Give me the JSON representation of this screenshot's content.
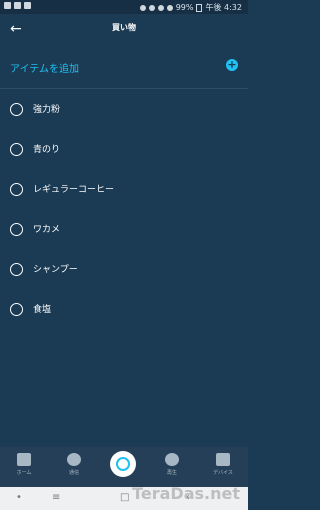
{
  "status_bar": {
    "battery": "99%",
    "time": "午後 4:32"
  },
  "header": {
    "title": "買い物",
    "back_icon": "arrow-left-icon"
  },
  "add_item": {
    "label": "アイテムを追加",
    "icon": "plus-circle-icon"
  },
  "items": [
    {
      "label": "強力粉",
      "checked": false
    },
    {
      "label": "青のり",
      "checked": false
    },
    {
      "label": "レギュラーコーヒー",
      "checked": false
    },
    {
      "label": "ワカメ",
      "checked": false
    },
    {
      "label": "シャンプー",
      "checked": false
    },
    {
      "label": "食塩",
      "checked": false
    }
  ],
  "bottom_nav": [
    {
      "label": "ホーム",
      "icon": "home-icon"
    },
    {
      "label": "通信",
      "icon": "chat-icon"
    },
    {
      "label": "",
      "icon": "alexa-icon"
    },
    {
      "label": "再生",
      "icon": "play-icon"
    },
    {
      "label": "デバイス",
      "icon": "devices-icon"
    }
  ],
  "watermark": "TeraDas.net",
  "colors": {
    "background": "#1b3a53",
    "accent": "#1fc0f2"
  }
}
